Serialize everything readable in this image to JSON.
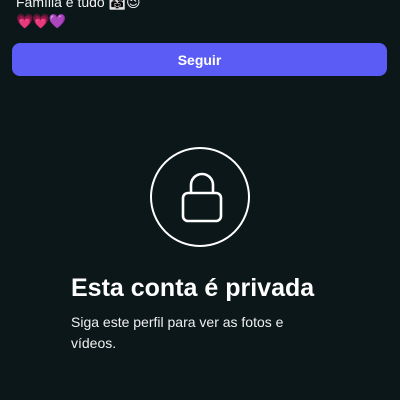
{
  "profile": {
    "bio_line1": "Família é tudo 👨‍👩‍👧😉",
    "bio_line2": "💗💗💜"
  },
  "actions": {
    "follow_label": "Seguir"
  },
  "private_notice": {
    "icon": "lock-icon",
    "title": "Esta conta é privada",
    "message": "Siga este perfil para ver as fotos e vídeos."
  },
  "colors": {
    "background": "#0b1719",
    "button": "#5b5cf6",
    "text": "#ffffff"
  }
}
